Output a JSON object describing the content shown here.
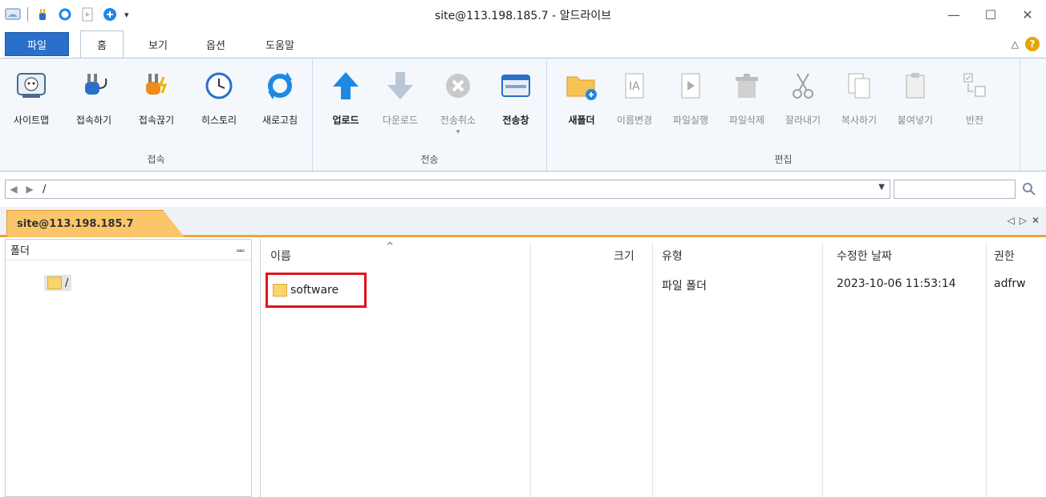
{
  "window": {
    "title": "site@113.198.185.7 - 알드라이브"
  },
  "ribbon_tabs": {
    "file": "파일",
    "home": "홈",
    "view": "보기",
    "options": "옵션",
    "help": "도움말"
  },
  "groups": {
    "connect": {
      "label": "접속",
      "buttons": [
        "사이트맵",
        "접속하기",
        "접속끊기",
        "히스토리",
        "새로고침"
      ]
    },
    "transfer": {
      "label": "전송",
      "buttons": [
        "업로드",
        "다운로드",
        "전송취소",
        "전송창"
      ]
    },
    "edit": {
      "label": "편집",
      "buttons": [
        "새폴더",
        "이름변경",
        "파일실행",
        "파일삭제",
        "잘라내기",
        "복사하기",
        "붙여넣기",
        "반전"
      ]
    }
  },
  "address": {
    "path": "/"
  },
  "session_tab": {
    "label": "site@113.198.185.7"
  },
  "folder_pane": {
    "header": "폴더",
    "root": "/"
  },
  "file_list": {
    "columns": [
      "이름",
      "크기",
      "유형",
      "수정한 날짜",
      "권한"
    ],
    "rows": [
      {
        "name": "software",
        "size": "",
        "type": "파일 폴더",
        "date": "2023-10-06 11:53:14",
        "perm": "adfrw"
      }
    ]
  },
  "colors": {
    "accent": "#2a6fc9",
    "session_tab": "#fbc66a",
    "highlight": "#e0141c"
  }
}
